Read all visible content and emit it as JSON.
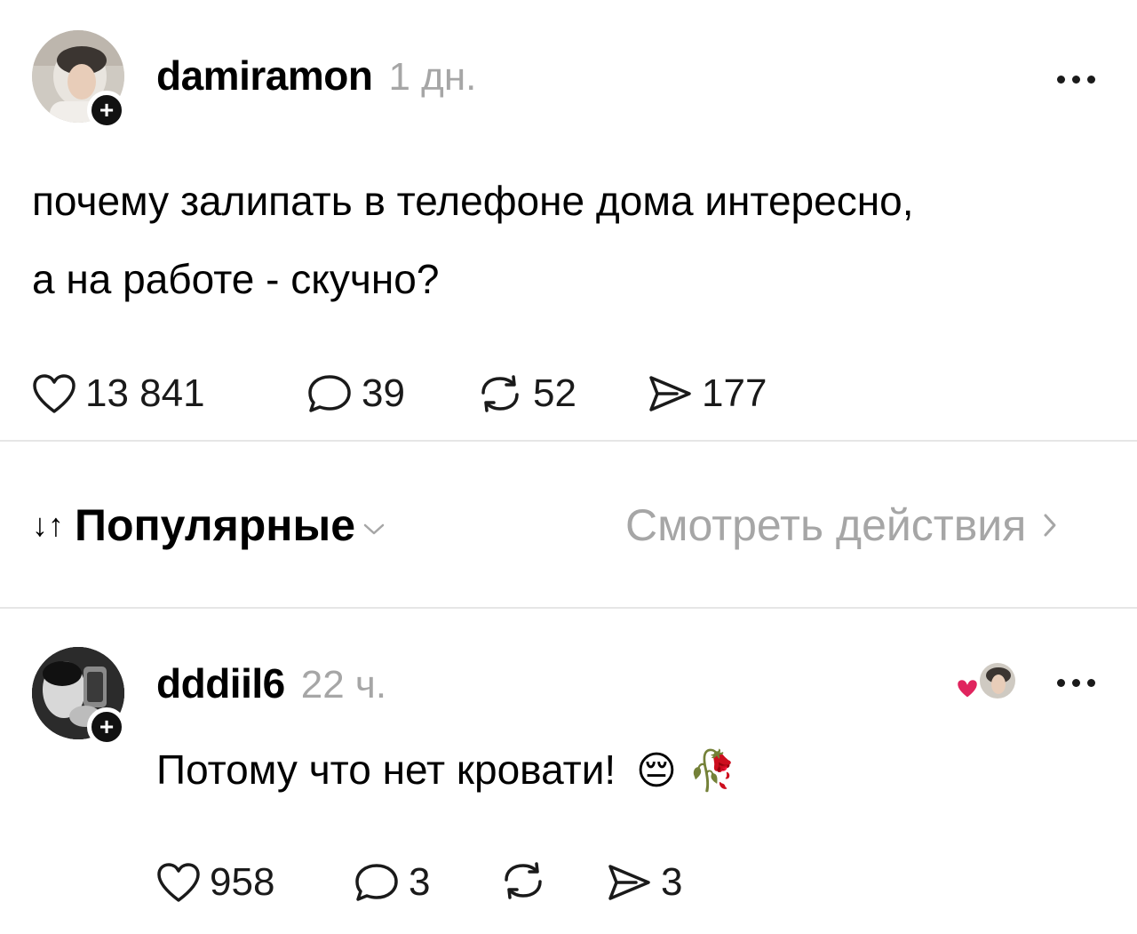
{
  "post": {
    "username": "damiramon",
    "time": "1 дн.",
    "text_line1": "почему залипать в телефоне дома интересно,",
    "text_line2": "а на работе - скучно?",
    "likes": "13 841",
    "comments": "39",
    "reposts": "52",
    "shares": "177",
    "follow_symbol": "+"
  },
  "sort_bar": {
    "arrows": "↓↑",
    "label": "Популярные",
    "view_activity": "Смотреть действия"
  },
  "reply": {
    "username": "dddiil6",
    "time": "22 ч.",
    "text": "Потому что нет кровати!",
    "emoji1": "😔",
    "emoji2": "🥀",
    "likes": "958",
    "comments": "3",
    "shares": "3",
    "follow_symbol": "+"
  },
  "icons": {
    "like": "heart-icon",
    "comment": "speech-bubble-icon",
    "repost": "repost-icon",
    "share": "paper-plane-icon",
    "more": "more-dots-icon",
    "chevron_down": "chevron-down-icon",
    "chevron_right": "chevron-right-icon"
  },
  "colors": {
    "text": "#000000",
    "muted": "#a6a6a6",
    "divider": "#e6e6e6",
    "liked_heart": "#e0245e"
  }
}
